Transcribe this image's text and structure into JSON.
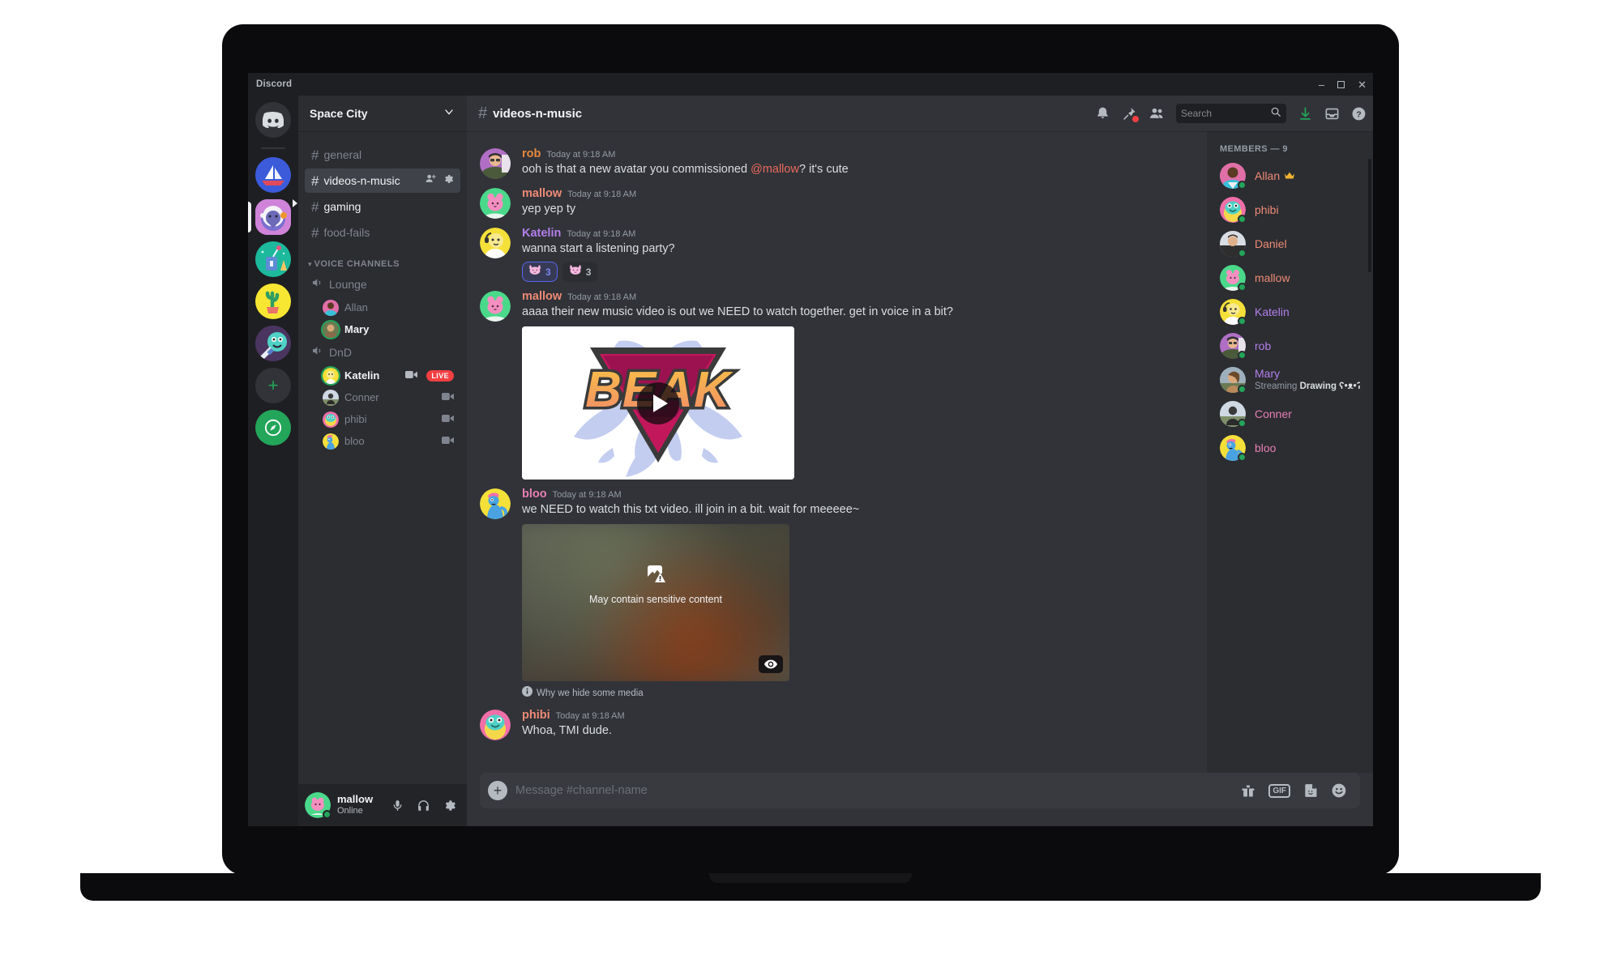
{
  "window": {
    "title": "Discord",
    "controls": {
      "minimize": "–",
      "maximize": "□",
      "close": "✕"
    }
  },
  "server_rail": {
    "home_label": "Discord Home",
    "servers": [
      {
        "name": "Sailboat Server",
        "colors": [
          "#3b5bdb",
          "#ffffff"
        ]
      },
      {
        "name": "Space City",
        "active": true,
        "colors": [
          "#c77dd8",
          "#7b6fd4"
        ]
      },
      {
        "name": "Art Server",
        "colors": [
          "#1abc9c",
          "#5d8bd4"
        ]
      },
      {
        "name": "Cactus Server",
        "colors": [
          "#f7e733",
          "#3aa76d"
        ]
      },
      {
        "name": "Monster Server",
        "colors": [
          "#5a3a6b",
          "#4fd1c5"
        ]
      }
    ],
    "add_server_label": "+",
    "explore_label": "Explore Public Servers"
  },
  "sidebar": {
    "server_name": "Space City",
    "text_channels": [
      {
        "name": "general",
        "state": "read"
      },
      {
        "name": "videos-n-music",
        "state": "active"
      },
      {
        "name": "gaming",
        "state": "unread"
      },
      {
        "name": "food-fails",
        "state": "read"
      }
    ],
    "voice_section_title": "Voice Channels",
    "voice_channels": [
      {
        "name": "Lounge",
        "members": [
          {
            "name": "Allan",
            "speaking": false,
            "avatar": "allan"
          },
          {
            "name": "Mary",
            "speaking": true,
            "avatar": "mary"
          }
        ]
      },
      {
        "name": "DnD",
        "members": [
          {
            "name": "Katelin",
            "speaking": true,
            "avatar": "katelin",
            "video": true,
            "live": "LIVE"
          },
          {
            "name": "Conner",
            "speaking": false,
            "avatar": "conner",
            "video": true
          },
          {
            "name": "phibi",
            "speaking": false,
            "avatar": "phibi",
            "video": true
          },
          {
            "name": "bloo",
            "speaking": false,
            "avatar": "bloo",
            "video": true
          }
        ]
      }
    ]
  },
  "user_panel": {
    "name": "mallow",
    "status": "Online",
    "mic_label": "Mute",
    "headphones_label": "Deafen",
    "settings_label": "User Settings"
  },
  "chat_header": {
    "channel_name": "videos-n-music",
    "hash": "#",
    "icons": [
      "notifications-bell-icon",
      "pinned-messages-icon",
      "member-list-icon",
      "download-icon",
      "inbox-icon",
      "help-icon"
    ]
  },
  "search": {
    "placeholder": "Search"
  },
  "messages": [
    {
      "author": "rob",
      "author_color": "#e8883c",
      "avatar": "rob",
      "time": "Today at 9:18 AM",
      "text_before": "ooh is that a new avatar you commissioned ",
      "mention": "@mallow",
      "text_after": "? it's cute"
    },
    {
      "author": "mallow",
      "author_color": "#ee8a76",
      "avatar": "mallow",
      "time": "Today at 9:18 AM",
      "text": "yep yep ty"
    },
    {
      "author": "Katelin",
      "author_color": "#b37feb",
      "avatar": "katelin",
      "time": "Today at 9:18 AM",
      "text": "wanna start a listening party?",
      "reactions": [
        {
          "emoji": "cat",
          "count": "3",
          "active": true
        },
        {
          "emoji": "cat",
          "count": "3",
          "active": false
        }
      ]
    },
    {
      "author": "mallow",
      "author_color": "#ee8a76",
      "avatar": "mallow",
      "time": "Today at 9:18 AM",
      "text": "aaaa their new music video is out we NEED to watch together. get in voice in a bit?",
      "video_embed": {
        "logo_text": "BEAK",
        "play_label": "Play"
      }
    },
    {
      "author": "bloo",
      "author_color": "#e87fb4",
      "avatar": "bloo",
      "time": "Today at 9:18 AM",
      "text": "we NEED to watch this txt video. ill join in a bit. wait for meeeee~",
      "sensitive_embed": {
        "warning": "May contain sensitive content",
        "note": "Why we hide some media",
        "reveal_label": "Show content"
      }
    },
    {
      "author": "phibi",
      "author_color": "#ee8a76",
      "avatar": "phibi",
      "time": "Today at 9:18 AM",
      "text": "Whoa, TMI dude."
    }
  ],
  "composer": {
    "placeholder": "Message #channel-name",
    "plus_label": "+",
    "gift_label": "Send a gift",
    "gif_label": "GIF",
    "sticker_label": "Sticker",
    "emoji_label": "Emoji"
  },
  "members": {
    "heading": "Members — 9",
    "list": [
      {
        "name": "Allan",
        "color": "#ee8a76",
        "avatar": "allan",
        "crown": true
      },
      {
        "name": "phibi",
        "color": "#ee8a76",
        "avatar": "phibi"
      },
      {
        "name": "Daniel",
        "color": "#ee8a76",
        "avatar": "daniel"
      },
      {
        "name": "mallow",
        "color": "#ee8a76",
        "avatar": "mallow"
      },
      {
        "name": "Katelin",
        "color": "#b37feb",
        "avatar": "katelin"
      },
      {
        "name": "rob",
        "color": "#b37feb",
        "avatar": "rob"
      },
      {
        "name": "Mary",
        "color": "#b37feb",
        "avatar": "mary",
        "activity_prefix": "Streaming ",
        "activity_bold": "Drawing ʕ•ᴥ•ʔ"
      },
      {
        "name": "Conner",
        "color": "#e87fb4",
        "avatar": "conner"
      },
      {
        "name": "bloo",
        "color": "#e87fb4",
        "avatar": "bloo"
      }
    ]
  },
  "colors": {
    "brand": "#5865f2",
    "online": "#23a55a",
    "live": "#f23f43",
    "bg_dark": "#1e1f22",
    "bg_sidebar": "#2b2d31",
    "bg_chat": "#313338"
  }
}
